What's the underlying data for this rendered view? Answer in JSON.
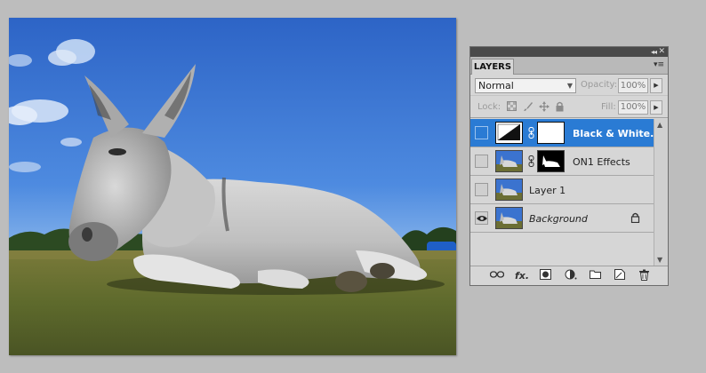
{
  "panel": {
    "tab_label": "LAYERS",
    "collapse_glyph": "◂◂",
    "close_glyph": "✕",
    "menu_glyph": "▾≡"
  },
  "blend": {
    "mode": "Normal",
    "opacity_label": "Opacity:",
    "opacity_value": "100%"
  },
  "lock": {
    "label": "Lock:",
    "fill_label": "Fill:",
    "fill_value": "100%"
  },
  "layers": [
    {
      "name": "Black & White...",
      "type": "adjustment",
      "visible": false,
      "selected": true,
      "mask": "white"
    },
    {
      "name": "ON1 Effects",
      "type": "pixel",
      "visible": false,
      "selected": false,
      "mask": "donkey-silhouette"
    },
    {
      "name": "Layer 1",
      "type": "pixel",
      "visible": false,
      "selected": false
    },
    {
      "name": "Background",
      "type": "background",
      "visible": true,
      "selected": false,
      "locked": true
    }
  ],
  "footer_icons": [
    "link-layers-icon",
    "fx-icon",
    "add-mask-icon",
    "adjustment-layer-icon",
    "group-icon",
    "new-layer-icon",
    "trash-icon"
  ],
  "footer_glyphs": {
    "fx": "fx."
  },
  "colors": {
    "selected": "#2a7bd4",
    "panel_bg": "#d6d6d6",
    "app_bg": "#bdbdbd"
  }
}
